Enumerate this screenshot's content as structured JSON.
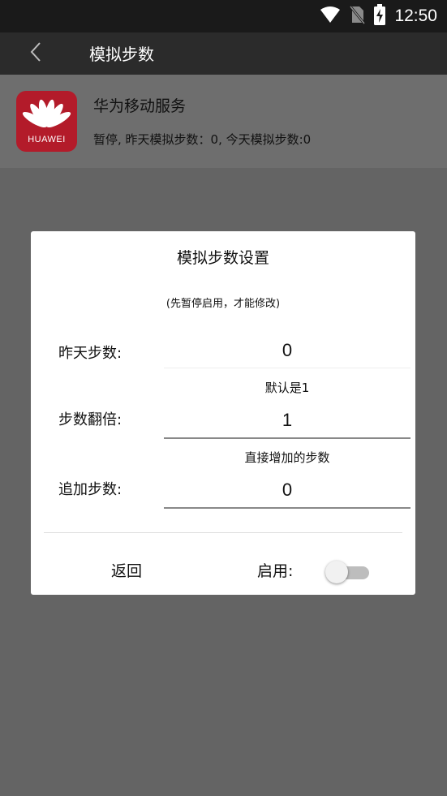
{
  "status_bar": {
    "time": "12:50"
  },
  "toolbar": {
    "title": "模拟步数"
  },
  "app": {
    "brand": "HUAWEI",
    "name": "华为移动服务",
    "status": "暂停, 昨天模拟步数：0, 今天模拟步数:0"
  },
  "dialog": {
    "title": "模拟步数设置",
    "note": "(先暂停启用，才能修改)",
    "fields": [
      {
        "label": "昨天步数:",
        "value": "0",
        "hint": ""
      },
      {
        "label": "步数翻倍:",
        "value": "1",
        "hint": "默认是1"
      },
      {
        "label": "追加步数:",
        "value": "0",
        "hint": "直接增加的步数"
      }
    ],
    "back_label": "返回",
    "enable_label": "启用:",
    "enabled": false
  },
  "colors": {
    "brand_red": "#b31b2a",
    "toolbar": "#2b2b2b",
    "status_bar": "#1a1a1a",
    "scrim": "#646464"
  }
}
